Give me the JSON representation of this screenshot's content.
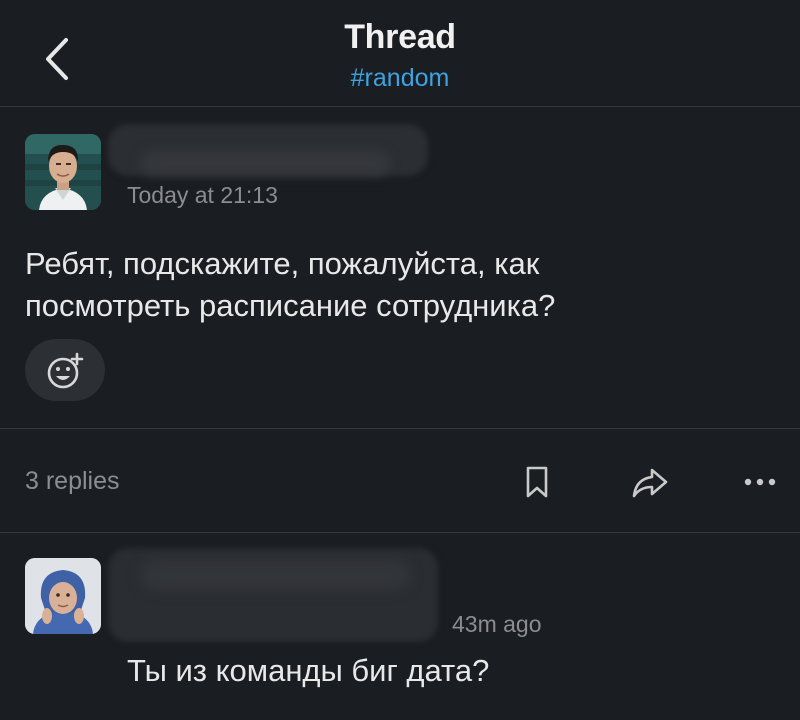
{
  "header": {
    "title": "Thread",
    "channel": "#random"
  },
  "parent_message": {
    "timestamp": "Today at 21:13",
    "text_line_1": "Ребят, подскажите, пожалуйста, как",
    "text_line_2": "посмотреть расписание сотрудника?"
  },
  "thread_footer": {
    "replies": "3 replies"
  },
  "reply": {
    "timestamp": "43m ago",
    "text": "Ты из команды биг дата?"
  },
  "icons": {
    "back": "chevron-left-icon",
    "reaction": "add-reaction-icon",
    "bookmark": "bookmark-icon",
    "share": "share-icon",
    "more": "more-horizontal-icon"
  },
  "colors": {
    "background": "#1a1d21",
    "channel_link": "#3ea3e0",
    "muted_text": "#8b8d90",
    "primary_text": "#e8e8e8"
  }
}
